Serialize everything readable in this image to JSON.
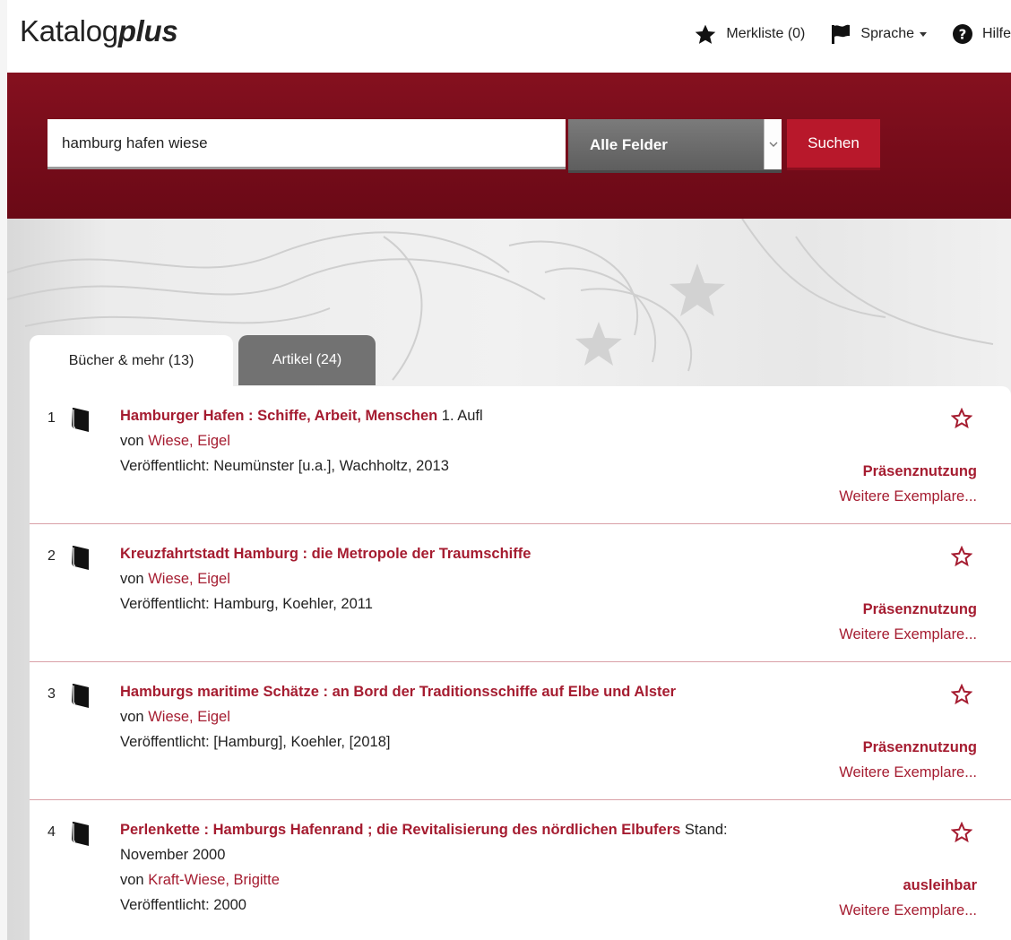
{
  "brand": {
    "prefix": "Katalog",
    "suffix": "plus"
  },
  "nav": {
    "merkliste": "Merkliste (0)",
    "sprache": "Sprache",
    "hilfe": "Hilfe"
  },
  "search": {
    "query": "hamburg hafen wiese",
    "field": "Alle Felder",
    "button": "Suchen"
  },
  "tabs": [
    {
      "label": "Bücher & mehr (13)",
      "active": true
    },
    {
      "label": "Artikel (24)",
      "active": false
    }
  ],
  "results": [
    {
      "num": "1",
      "title": "Hamburger Hafen : Schiffe, Arbeit, Menschen",
      "edition": "1. Aufl",
      "by": "von",
      "author": "Wiese, Eigel",
      "published": "Veröffentlicht: Neumünster [u.a.], Wachholtz, 2013",
      "status": "Präsenznutzung",
      "more": "Weitere Exemplare..."
    },
    {
      "num": "2",
      "title": "Kreuzfahrtstadt Hamburg : die Metropole der Traumschiffe",
      "edition": "",
      "by": "von",
      "author": "Wiese, Eigel",
      "published": "Veröffentlicht: Hamburg, Koehler, 2011",
      "status": "Präsenznutzung",
      "more": "Weitere Exemplare..."
    },
    {
      "num": "3",
      "title": "Hamburgs maritime Schätze : an Bord der Traditionsschiffe auf Elbe und Alster",
      "edition": "",
      "by": "von",
      "author": "Wiese, Eigel",
      "published": "Veröffentlicht: [Hamburg], Koehler, [2018]",
      "status": "Präsenznutzung",
      "more": "Weitere Exemplare..."
    },
    {
      "num": "4",
      "title": "Perlenkette : Hamburgs Hafenrand ; die Revitalisierung des nördlichen Elbufers",
      "edition": "Stand: November 2000",
      "by": "von",
      "author": "Kraft-Wiese, Brigitte",
      "published": "Veröffentlicht: 2000",
      "status": "ausleihbar",
      "more": "Weitere Exemplare..."
    }
  ],
  "colors": {
    "accent": "#a51c30",
    "hero": "#7a0d1b"
  }
}
